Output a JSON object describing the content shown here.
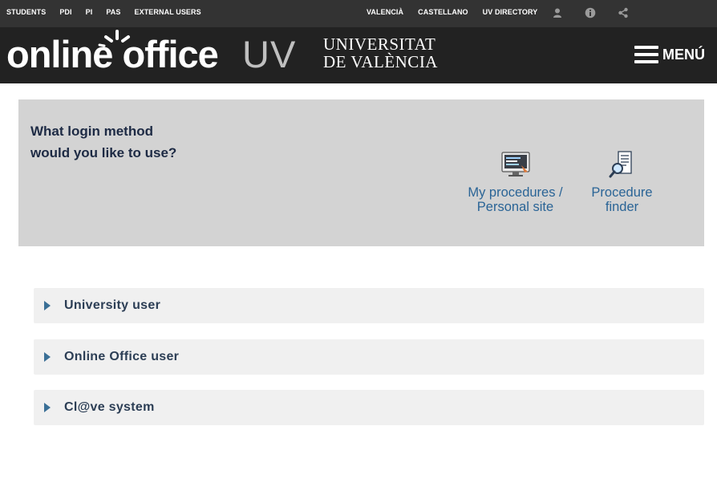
{
  "topbar": {
    "left_links": [
      "STUDENTS",
      "PDI",
      "PI",
      "PAS",
      "EXTERNAL USERS"
    ],
    "right_links": [
      "VALENCIÀ",
      "CASTELLANO",
      "UV DIRECTORY"
    ],
    "icons": [
      "user-icon",
      "info-icon",
      "share-icon"
    ]
  },
  "header": {
    "brand_main": "online office",
    "brand_suffix": "UV",
    "university_line1": "UNIVERSITAT",
    "university_line2": "DE VALÈNCIA",
    "menu_label": "MENÚ"
  },
  "login_panel": {
    "question": "What login method would you like to use?",
    "shortcuts": [
      {
        "label_line1": "My procedures /",
        "label_line2": "Personal site",
        "icon": "computer-screen-icon"
      },
      {
        "label_line1": "Procedure",
        "label_line2": "finder",
        "icon": "document-search-icon"
      }
    ]
  },
  "accordion": [
    {
      "title": "University user"
    },
    {
      "title": "Online Office user"
    },
    {
      "title": "Cl@ve system"
    }
  ],
  "colors": {
    "topbar_bg": "#333333",
    "header_bg": "#222222",
    "panel_bg": "#d3d3d3",
    "link_blue": "#2a6496",
    "accordion_bg": "#f0f0f0"
  }
}
